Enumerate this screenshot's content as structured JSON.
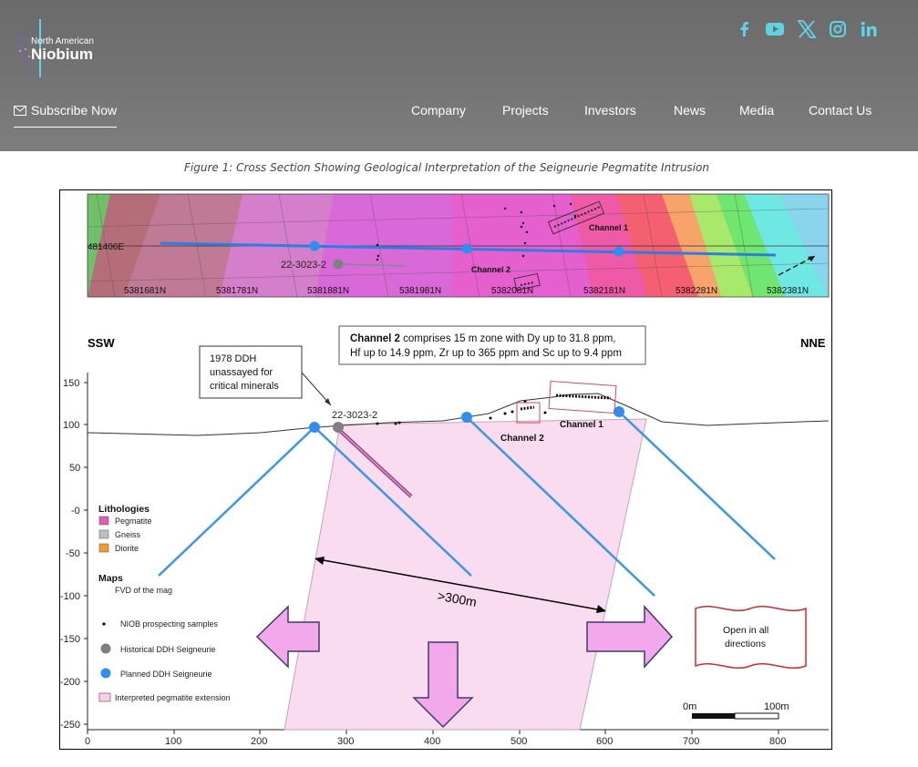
{
  "header": {
    "logo_small": "North American",
    "logo_big": "Niobium",
    "subscribe_label": "Subscribe Now",
    "nav": [
      "Company",
      "Projects",
      "Investors",
      "News",
      "Media",
      "Contact Us"
    ],
    "social_icons": [
      "facebook-icon",
      "youtube-icon",
      "x-icon",
      "instagram-icon",
      "linkedin-icon"
    ],
    "accent_color": "#5fd3e6"
  },
  "caption": "Figure 1: Cross Section Showing Geological Interpretation of the Seigneurie Pegmatite Intrusion",
  "figure": {
    "map": {
      "easting_label": "481406E",
      "northing_labels": [
        "5381681N",
        "5381781N",
        "5381881N",
        "5381981N",
        "5382081N",
        "5382181N",
        "5382281N",
        "5382381N"
      ],
      "hole_label": "22-3023-2",
      "channel1_label": "Channel 1",
      "channel2_label": "Channel 2"
    },
    "section": {
      "left_label": "SSW",
      "right_label": "NNE",
      "callout_channel2_bold": "Channel 2",
      "callout_channel2_line1": " comprises 15 m zone with Dy up to 31.8 ppm,",
      "callout_channel2_line2": "Hf up to 14.9 ppm, Zr up to 365 ppm and Sc up to 9.4 ppm",
      "callout_ddh_lines": [
        "1978 DDH",
        "unassayed for",
        "critical minerals"
      ],
      "hole_label": "22-3023-2",
      "channel1_label": "Channel 1",
      "channel2_label": "Channel 2",
      "width_label": ">300m",
      "open_lines": [
        "Open in all",
        "directions"
      ],
      "scale_start": "0m",
      "scale_end": "100m"
    },
    "legend": {
      "lithologies_title": "Lithologies",
      "lithologies": [
        {
          "label": "Pegmatite",
          "color": "#e35bb4"
        },
        {
          "label": "Gneiss",
          "color": "#bdbdbd"
        },
        {
          "label": "Diorite",
          "color": "#f39c28"
        }
      ],
      "maps_title": "Maps",
      "maps_sub": "FVD of the mag",
      "symbols": [
        {
          "label": "NIOB prospecting samples",
          "symbol": "dot"
        },
        {
          "label": "Historical DDH Seigneurie",
          "symbol": "grey-circle"
        },
        {
          "label": "Planned DDH Seigneurie",
          "symbol": "blue-circle"
        },
        {
          "label": "Interpreted pegmatite extension",
          "symbol": "pink-box"
        }
      ]
    },
    "y_ticks": [
      "150",
      "100",
      "50",
      "-0",
      "-50",
      "-100",
      "-150",
      "-200",
      "-250"
    ],
    "x_ticks": [
      "0",
      "100",
      "200",
      "300",
      "400",
      "500",
      "600",
      "700",
      "800"
    ]
  }
}
